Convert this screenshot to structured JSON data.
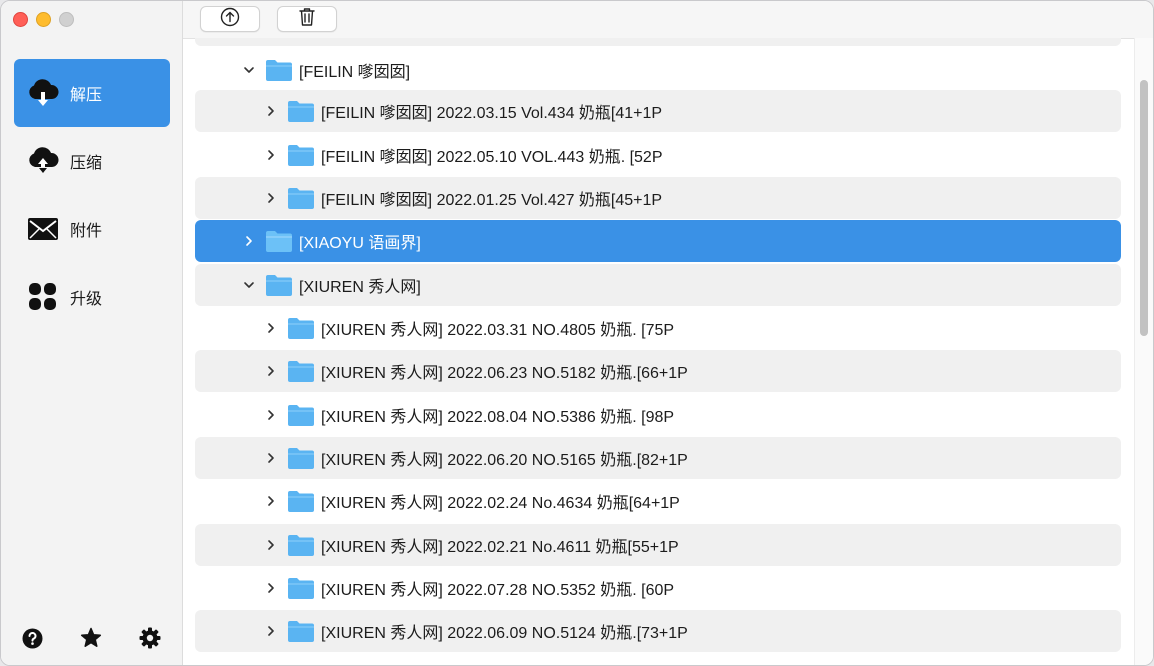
{
  "sidebar": {
    "items": [
      {
        "label": "解压",
        "icon": "cloud-download-icon",
        "active": true
      },
      {
        "label": "压缩",
        "icon": "cloud-upload-icon",
        "active": false
      },
      {
        "label": "附件",
        "icon": "envelope-icon",
        "active": false
      },
      {
        "label": "升级",
        "icon": "grid-icon",
        "active": false
      }
    ],
    "bottom_icons": [
      "help-icon",
      "star-icon",
      "gear-icon"
    ]
  },
  "toolbar": {
    "buttons": [
      "upload-icon",
      "trash-icon"
    ]
  },
  "tree": {
    "rows": [
      {
        "label": "[FEILIN 嗲囡囡]",
        "level": 0,
        "expanded": true
      },
      {
        "label": "[FEILIN 嗲囡囡] 2022.03.15 Vol.434 奶瓶[41+1P",
        "level": 1,
        "expanded": false
      },
      {
        "label": "[FEILIN 嗲囡囡] 2022.05.10 VOL.443 奶瓶. [52P",
        "level": 1,
        "expanded": false
      },
      {
        "label": "[FEILIN 嗲囡囡] 2022.01.25 Vol.427 奶瓶[45+1P",
        "level": 1,
        "expanded": false
      },
      {
        "label": "[XIAOYU 语画界]",
        "level": 0,
        "expanded": false,
        "selected": true
      },
      {
        "label": "[XIUREN 秀人网]",
        "level": 0,
        "expanded": true
      },
      {
        "label": "[XIUREN 秀人网] 2022.03.31 NO.4805 奶瓶. [75P",
        "level": 1,
        "expanded": false
      },
      {
        "label": "[XIUREN 秀人网] 2022.06.23 NO.5182 奶瓶.[66+1P",
        "level": 1,
        "expanded": false
      },
      {
        "label": "[XIUREN 秀人网] 2022.08.04 NO.5386 奶瓶. [98P",
        "level": 1,
        "expanded": false
      },
      {
        "label": "[XIUREN 秀人网] 2022.06.20 NO.5165 奶瓶.[82+1P",
        "level": 1,
        "expanded": false
      },
      {
        "label": "[XIUREN 秀人网] 2022.02.24 No.4634 奶瓶[64+1P",
        "level": 1,
        "expanded": false
      },
      {
        "label": "[XIUREN 秀人网] 2022.02.21 No.4611 奶瓶[55+1P",
        "level": 1,
        "expanded": false
      },
      {
        "label": "[XIUREN 秀人网] 2022.07.28 NO.5352 奶瓶. [60P",
        "level": 1,
        "expanded": false
      },
      {
        "label": "[XIUREN 秀人网] 2022.06.09 NO.5124 奶瓶.[73+1P",
        "level": 1,
        "expanded": false
      }
    ]
  },
  "colors": {
    "accent": "#3a91e6",
    "folder": "#5ab4f2",
    "row_alt": "#f0f0f0"
  }
}
